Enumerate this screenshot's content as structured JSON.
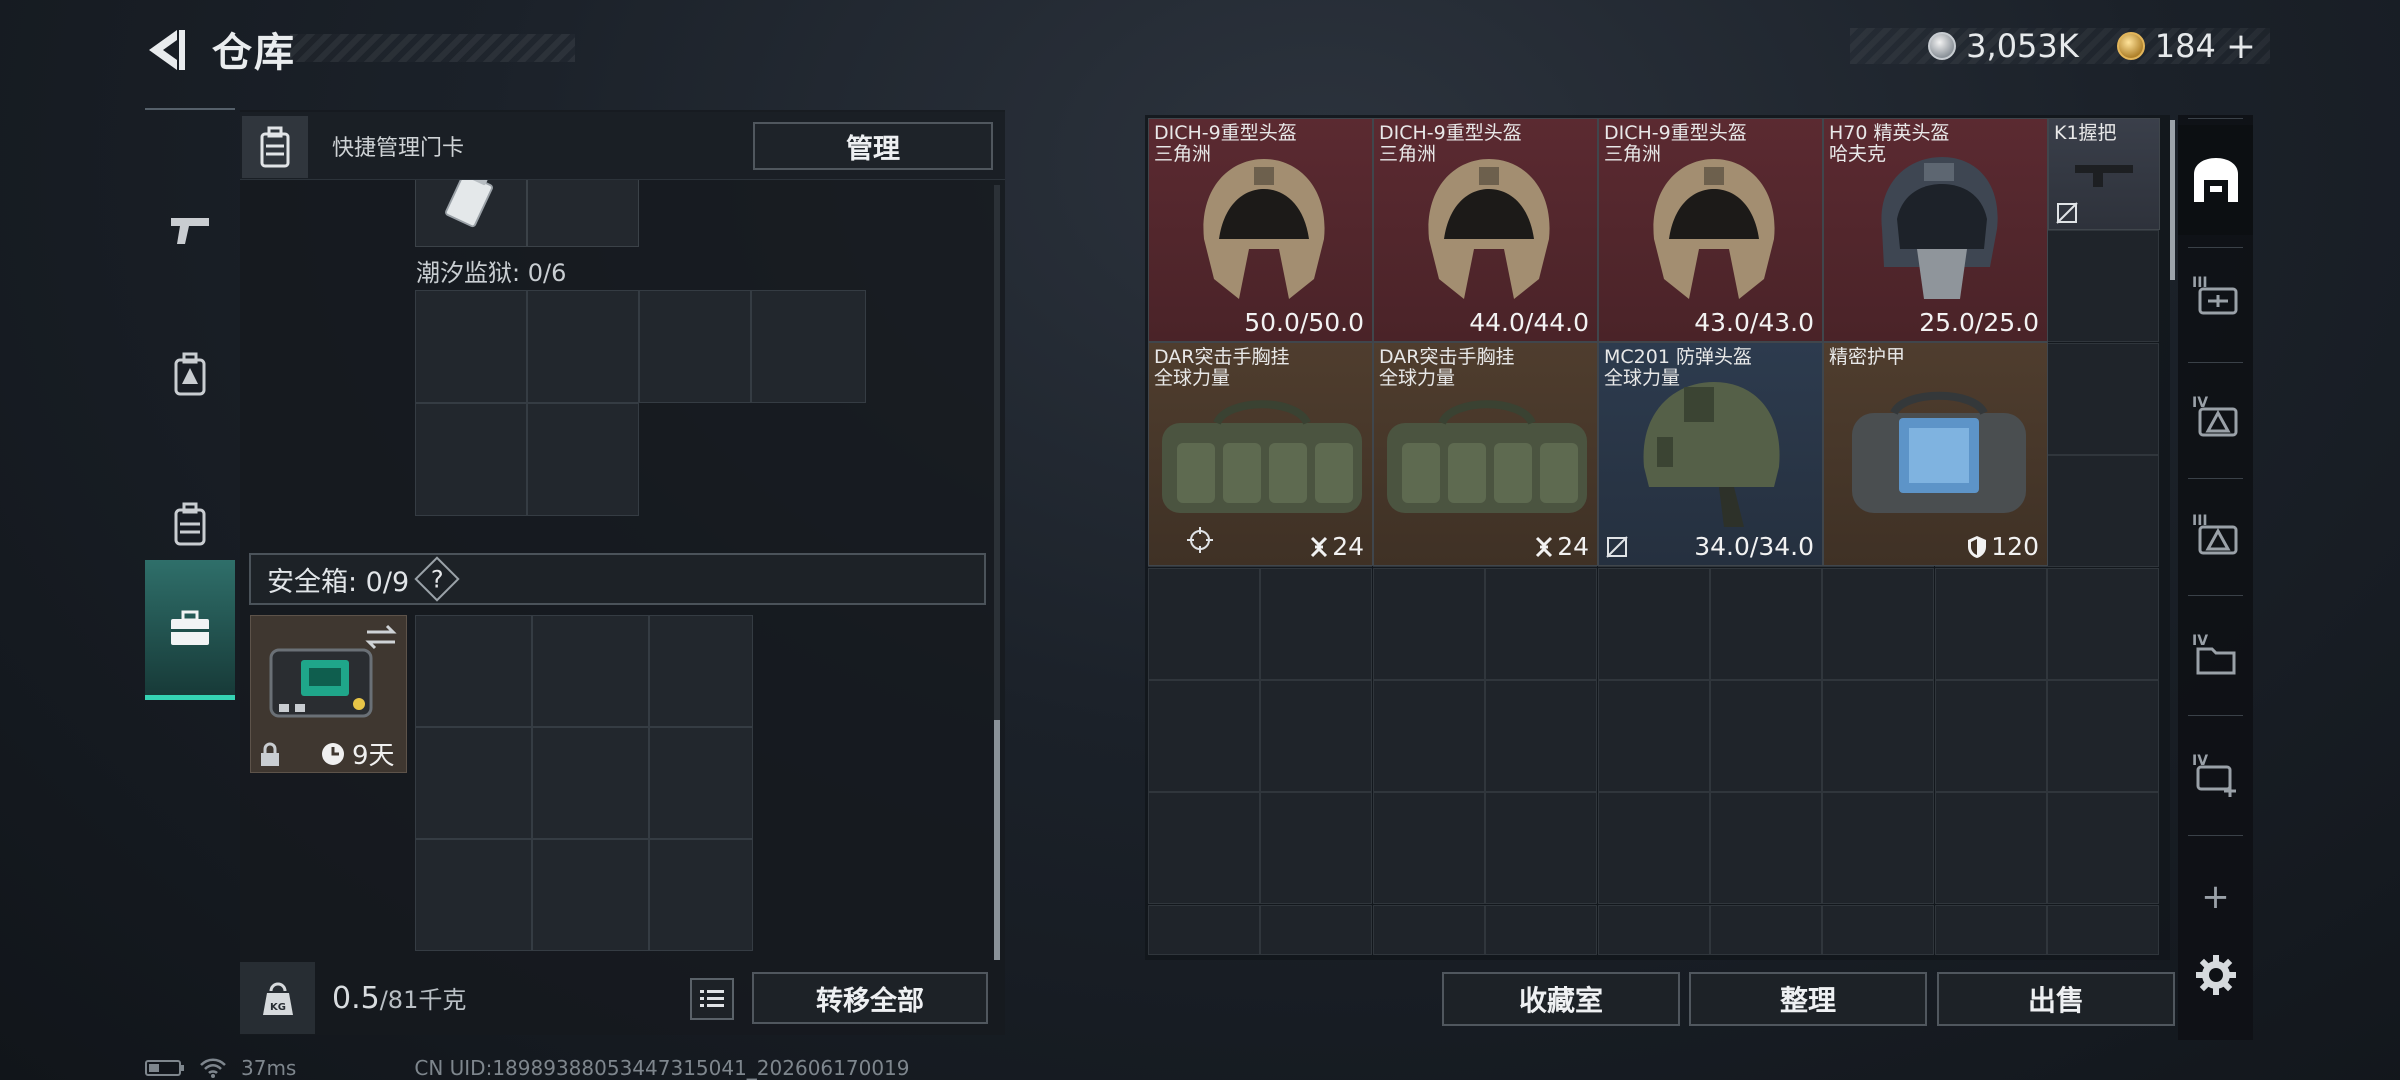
{
  "header": {
    "title": "仓库",
    "currency": [
      {
        "icon": "silver-coin-icon",
        "value": "3,053K"
      },
      {
        "icon": "gold-coin-icon",
        "value": "184"
      }
    ],
    "add_label": "+"
  },
  "left_tabs": [
    {
      "icon": "gun-icon",
      "active": false
    },
    {
      "icon": "backpack-badge-icon",
      "active": false
    },
    {
      "icon": "backpack-icon",
      "active": false
    },
    {
      "icon": "toolbox-icon",
      "active": true
    }
  ],
  "quick_manage": {
    "label": "快捷管理门卡",
    "button": "管理"
  },
  "tide_prison": {
    "label": "潮汐监狱: 0/6"
  },
  "safe_box": {
    "label": "安全箱: 0/9",
    "help": "?",
    "days": "9天"
  },
  "weight": {
    "current": "0.5",
    "max": "/81千克"
  },
  "transfer_all": "转移全部",
  "stash_items": [
    {
      "name": "DICH-9重型头盔",
      "sub": "三角洲",
      "value": "50.0/50.0",
      "rarity": "red"
    },
    {
      "name": "DICH-9重型头盔",
      "sub": "三角洲",
      "value": "44.0/44.0",
      "rarity": "red"
    },
    {
      "name": "DICH-9重型头盔",
      "sub": "三角洲",
      "value": "43.0/43.0",
      "rarity": "red"
    },
    {
      "name": "H70 精英头盔",
      "sub": "哈夫克",
      "value": "25.0/25.0",
      "rarity": "red"
    },
    {
      "name": "K1握把",
      "sub": "",
      "value": "",
      "rarity": "gray"
    },
    {
      "name": "DAR突击手胸挂",
      "sub": "全球力量",
      "value": "24",
      "rarity": "brown"
    },
    {
      "name": "DAR突击手胸挂",
      "sub": "全球力量",
      "value": "24",
      "rarity": "brown"
    },
    {
      "name": "MC201 防弹头盔",
      "sub": "全球力量",
      "value": "34.0/34.0",
      "rarity": "blue"
    },
    {
      "name": "精密护甲",
      "sub": "",
      "value": "120",
      "rarity": "brown"
    }
  ],
  "side_tabs": [
    {
      "icon": "stash-home-icon",
      "label": ""
    },
    {
      "icon": "tier-3-weapon-case-icon",
      "label": "III"
    },
    {
      "icon": "tier-4-equipment-case-icon",
      "label": "IV"
    },
    {
      "icon": "tier-3-equipment-case-icon",
      "label": "III"
    },
    {
      "icon": "tier-4-folder-case-icon",
      "label": "IV"
    },
    {
      "icon": "tier-4-add-case-icon",
      "label": "IV"
    },
    {
      "icon": "add-icon",
      "label": "+"
    }
  ],
  "bottom_buttons": {
    "collection": "收藏室",
    "organize": "整理",
    "sell": "出售"
  },
  "footer": {
    "ping": "37ms",
    "uid": "CN UID:18989388053447315041_202606170019"
  },
  "colors": {
    "accent": "#35d3b3",
    "rarity_red": "#5b2a31",
    "rarity_brown": "#4f3d2e",
    "rarity_blue": "#2d3b4e"
  }
}
